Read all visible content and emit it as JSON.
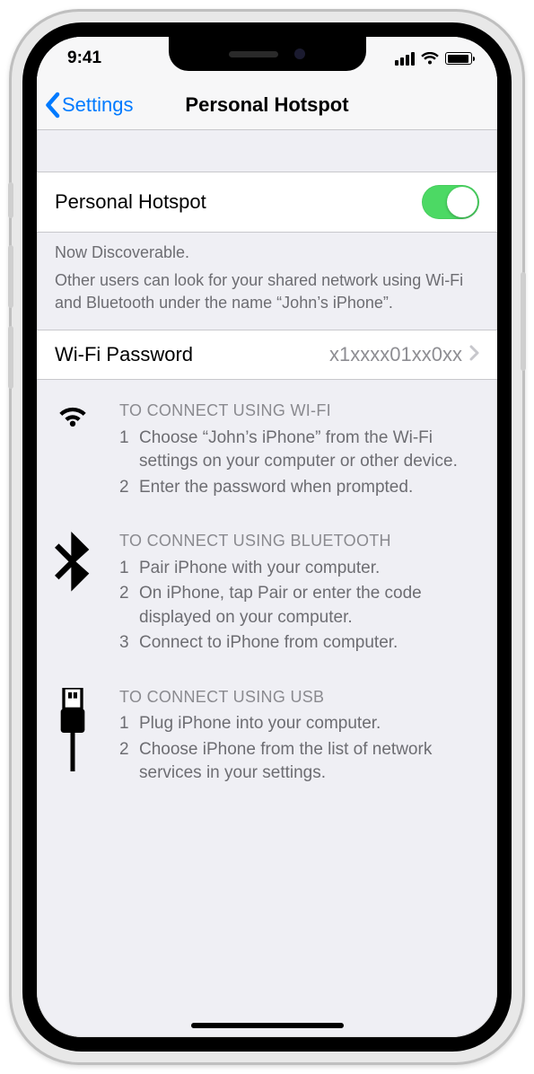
{
  "status": {
    "time": "9:41"
  },
  "nav": {
    "back": "Settings",
    "title": "Personal Hotspot"
  },
  "hotspot_toggle": {
    "label": "Personal Hotspot",
    "on": true
  },
  "discoverable": {
    "line1": "Now Discoverable.",
    "line2": "Other users can look for your shared network using Wi-Fi and Bluetooth under the name “John’s iPhone”."
  },
  "wifi_password": {
    "label": "Wi-Fi Password",
    "value": "x1xxxx01xx0xx"
  },
  "instructions": {
    "wifi": {
      "title": "To Connect Using Wi-Fi",
      "steps": [
        "Choose “John’s iPhone” from the Wi-Fi settings on your computer or other device.",
        "Enter the password when prompted."
      ]
    },
    "bluetooth": {
      "title": "To Connect Using Bluetooth",
      "steps": [
        "Pair iPhone with your computer.",
        "On iPhone, tap Pair or enter the code displayed on your computer.",
        "Connect to iPhone from computer."
      ]
    },
    "usb": {
      "title": "To Connect Using USB",
      "steps": [
        "Plug iPhone into your computer.",
        "Choose iPhone from the list of network services in your settings."
      ]
    }
  }
}
